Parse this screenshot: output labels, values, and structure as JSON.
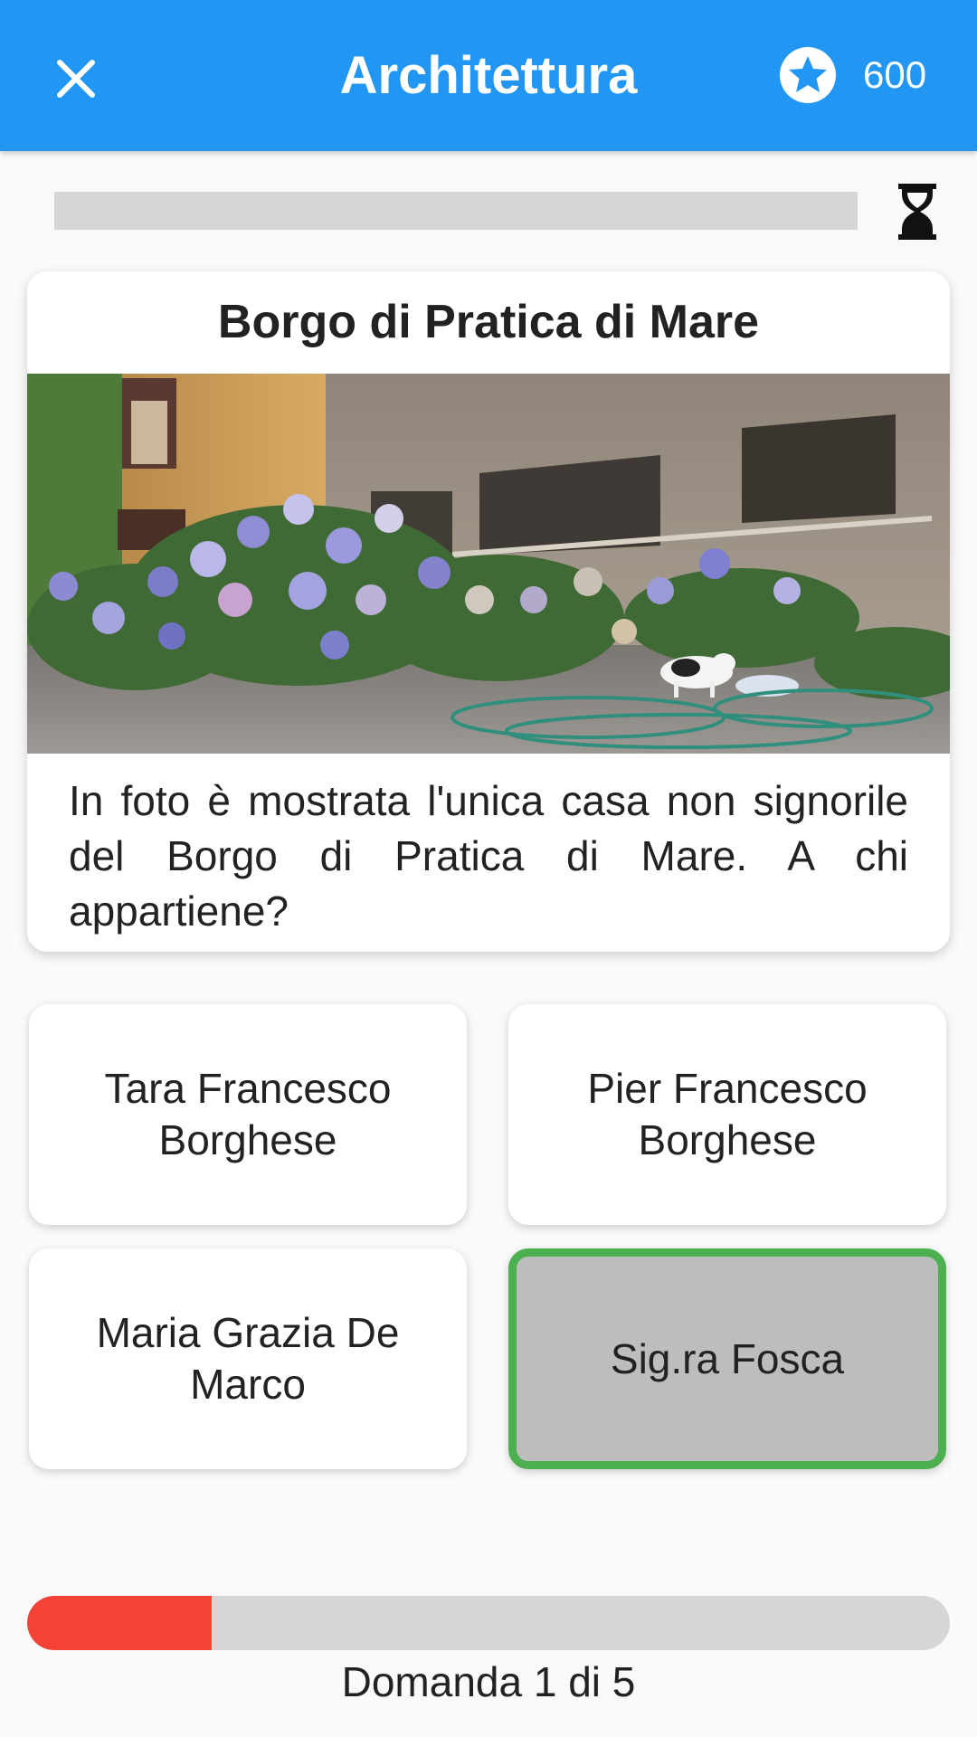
{
  "header": {
    "title": "Architettura",
    "close_icon": "close-icon",
    "score_icon": "star-circle-icon",
    "score": "600",
    "background": "#2196f3"
  },
  "timer": {
    "icon": "hourglass-icon",
    "remaining_fraction": 0.0
  },
  "question_card": {
    "title": "Borgo di Pratica di Mare",
    "question": "In foto è mostrata l'unica casa non signorile del Borgo di Pratica di Mare. A chi appartiene?"
  },
  "answers": [
    {
      "label": "Tara Francesco Borghese",
      "selected": false
    },
    {
      "label": "Pier Francesco Borghese",
      "selected": false
    },
    {
      "label": "Maria Grazia De Marco",
      "selected": false
    },
    {
      "label": "Sig.ra Fosca",
      "selected": true
    }
  ],
  "colors": {
    "selected_border": "#4caf50",
    "progress": "#f44336"
  },
  "progress": {
    "label": "Domanda 1 di 5",
    "current": 1,
    "total": 5
  }
}
